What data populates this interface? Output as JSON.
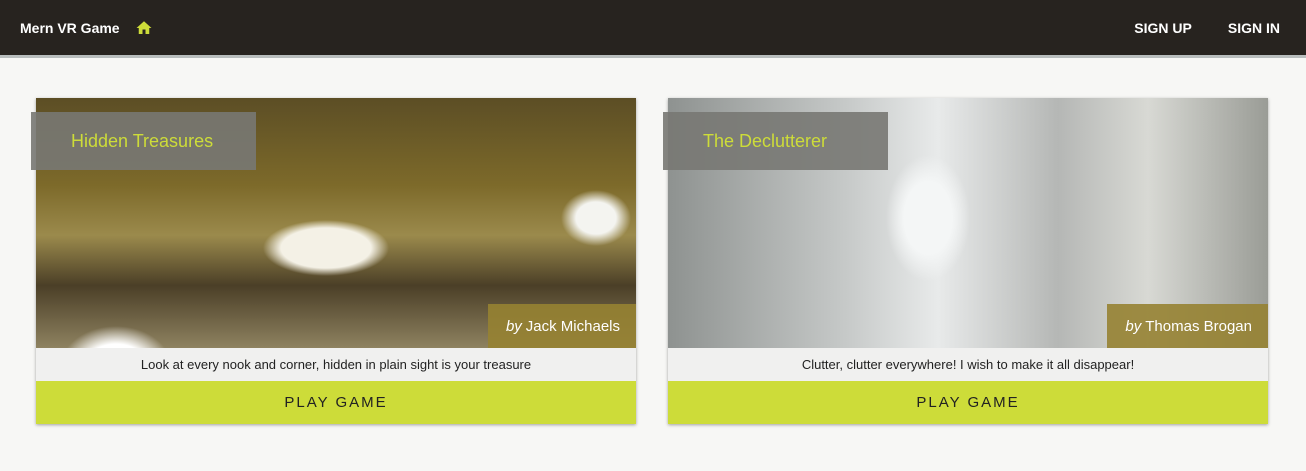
{
  "header": {
    "brand": "Mern VR Game",
    "sign_up": "SIGN UP",
    "sign_in": "SIGN IN"
  },
  "games": [
    {
      "title": "Hidden Treasures",
      "by": "by",
      "author": "Jack Michaels",
      "description": "Look at every nook and corner, hidden in plain sight is your treasure",
      "play": "PLAY GAME"
    },
    {
      "title": "The Declutterer",
      "by": "by",
      "author": "Thomas Brogan",
      "description": "Clutter, clutter everywhere! I wish to make it all disappear!",
      "play": "PLAY GAME"
    }
  ],
  "colors": {
    "accent": "#cddc39",
    "appbar": "#27231f"
  }
}
